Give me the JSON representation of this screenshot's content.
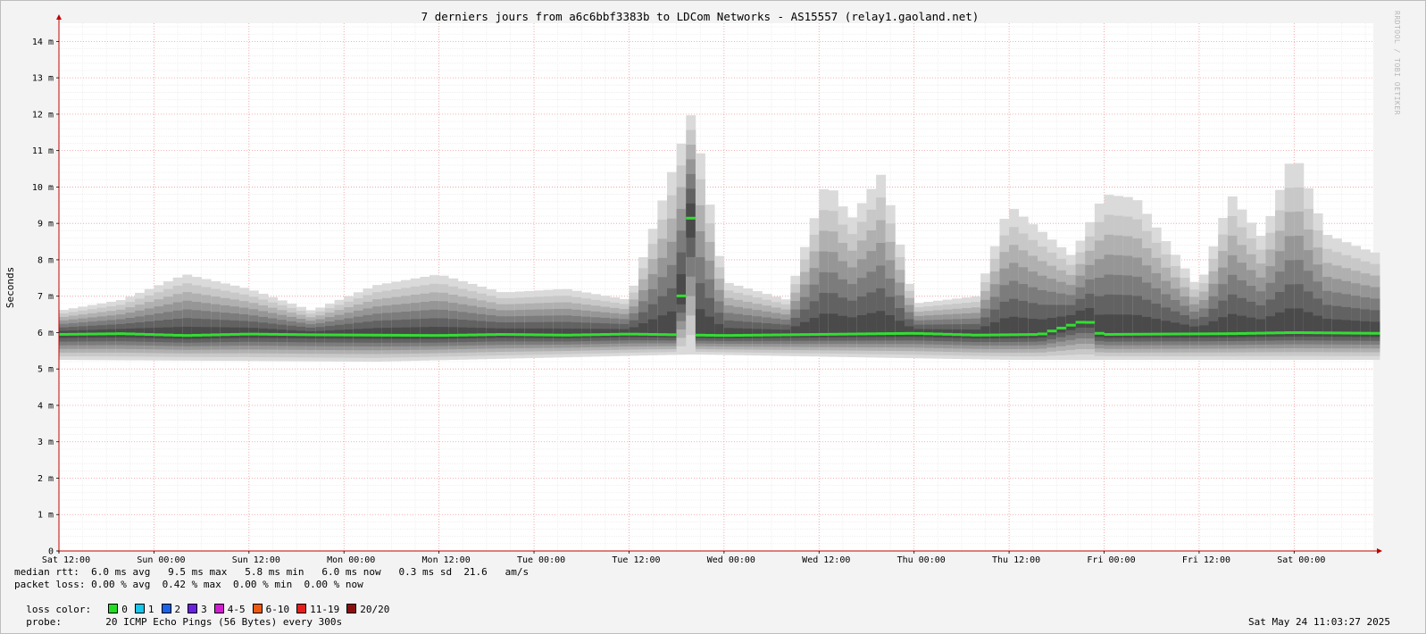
{
  "chart_data": {
    "type": "smokeping",
    "title": "7 derniers jours from a6c6bbf3383b to LDCom Networks - AS15557 (relay1.gaoland.net)",
    "ylabel": "Seconds",
    "ylim": [
      0,
      14.5
    ],
    "yticks": [
      "0",
      "1 m",
      "2 m",
      "3 m",
      "4 m",
      "5 m",
      "6 m",
      "7 m",
      "8 m",
      "9 m",
      "10 m",
      "11 m",
      "12 m",
      "13 m",
      "14 m"
    ],
    "ytick_values": [
      0,
      1,
      2,
      3,
      4,
      5,
      6,
      7,
      8,
      9,
      10,
      11,
      12,
      13,
      14
    ],
    "x_unit": "hours since start",
    "xlim": [
      0,
      166
    ],
    "xticks": [
      {
        "label": "Sat 12:00",
        "hours": 0
      },
      {
        "label": "Sun 00:00",
        "hours": 12
      },
      {
        "label": "Sun 12:00",
        "hours": 24
      },
      {
        "label": "Mon 00:00",
        "hours": 36
      },
      {
        "label": "Mon 12:00",
        "hours": 48
      },
      {
        "label": "Tue 00:00",
        "hours": 60
      },
      {
        "label": "Tue 12:00",
        "hours": 72
      },
      {
        "label": "Wed 00:00",
        "hours": 84
      },
      {
        "label": "Wed 12:00",
        "hours": 96
      },
      {
        "label": "Thu 00:00",
        "hours": 108
      },
      {
        "label": "Thu 12:00",
        "hours": 120
      },
      {
        "label": "Fri 00:00",
        "hours": 132
      },
      {
        "label": "Fri 12:00",
        "hours": 144
      },
      {
        "label": "Sat 00:00",
        "hours": 156
      }
    ],
    "grid": true,
    "series": [
      {
        "name": "median rtt (ms)",
        "x_hours": [
          0,
          8,
          16,
          24,
          32,
          40,
          48,
          56,
          64,
          72,
          78,
          80,
          81,
          84,
          92,
          100,
          108,
          116,
          124,
          130,
          131,
          132,
          140,
          148,
          156,
          166
        ],
        "values": [
          5.95,
          5.97,
          5.92,
          5.96,
          5.94,
          5.93,
          5.92,
          5.95,
          5.93,
          5.96,
          5.94,
          9.5,
          5.93,
          5.92,
          5.94,
          5.96,
          5.98,
          5.93,
          5.95,
          6.35,
          6.0,
          5.95,
          5.96,
          5.97,
          6.0,
          5.98
        ],
        "color": "#33dd33"
      },
      {
        "name": "max rtt (ms)",
        "x_hours": [
          0,
          8,
          16,
          24,
          32,
          40,
          48,
          56,
          64,
          72,
          80,
          84,
          92,
          97,
          100,
          104,
          108,
          116,
          120,
          128,
          132,
          136,
          144,
          148,
          152,
          156,
          160,
          166
        ],
        "values": [
          6.6,
          6.9,
          7.6,
          7.2,
          6.6,
          7.3,
          7.6,
          7.1,
          7.2,
          6.9,
          12.1,
          7.4,
          6.9,
          10.2,
          9.1,
          10.4,
          6.8,
          7.0,
          9.5,
          8.1,
          9.8,
          9.7,
          7.2,
          9.8,
          8.6,
          11.0,
          8.7,
          8.2
        ],
        "color": "#d9d9d9"
      },
      {
        "name": "min rtt (ms)",
        "x_hours": [
          0,
          40,
          80,
          120,
          166
        ],
        "values": [
          5.25,
          5.2,
          5.4,
          5.25,
          5.25
        ],
        "color": "#d9d9d9"
      }
    ],
    "colors": {
      "background": "#f3f3f3",
      "plot_background": "#ffffff",
      "grid_major": "#ef9a9a",
      "grid_minor": "#ececec",
      "axis": "#c00000",
      "median": "#33dd33",
      "smoke_dark": "#4a4a4a",
      "smoke_light": "#dadada"
    }
  },
  "stats": {
    "median_line": "median rtt:  6.0 ms avg   9.5 ms max   5.8 ms min   6.0 ms now   0.3 ms sd  21.6   am/s",
    "loss_line": "packet loss: 0.00 % avg  0.42 % max  0.00 % min  0.00 % now",
    "loss_color_label": "loss color:",
    "probe_label": "probe:",
    "probe_text": "20 ICMP Echo Pings (56 Bytes) every 300s",
    "timestamp": "Sat May 24 11:03:27 2025",
    "watermark": "RRDTOOL / TOBI OETIKER"
  },
  "loss_legend": [
    {
      "label": "0",
      "color": "#22dd22"
    },
    {
      "label": "1",
      "color": "#17c6e8"
    },
    {
      "label": "2",
      "color": "#1c62ea"
    },
    {
      "label": "3",
      "color": "#6a22e0"
    },
    {
      "label": "4-5",
      "color": "#d21cd2"
    },
    {
      "label": "6-10",
      "color": "#ee5a10"
    },
    {
      "label": "11-19",
      "color": "#e81c1c"
    },
    {
      "label": "20/20",
      "color": "#8c0f0f"
    }
  ]
}
